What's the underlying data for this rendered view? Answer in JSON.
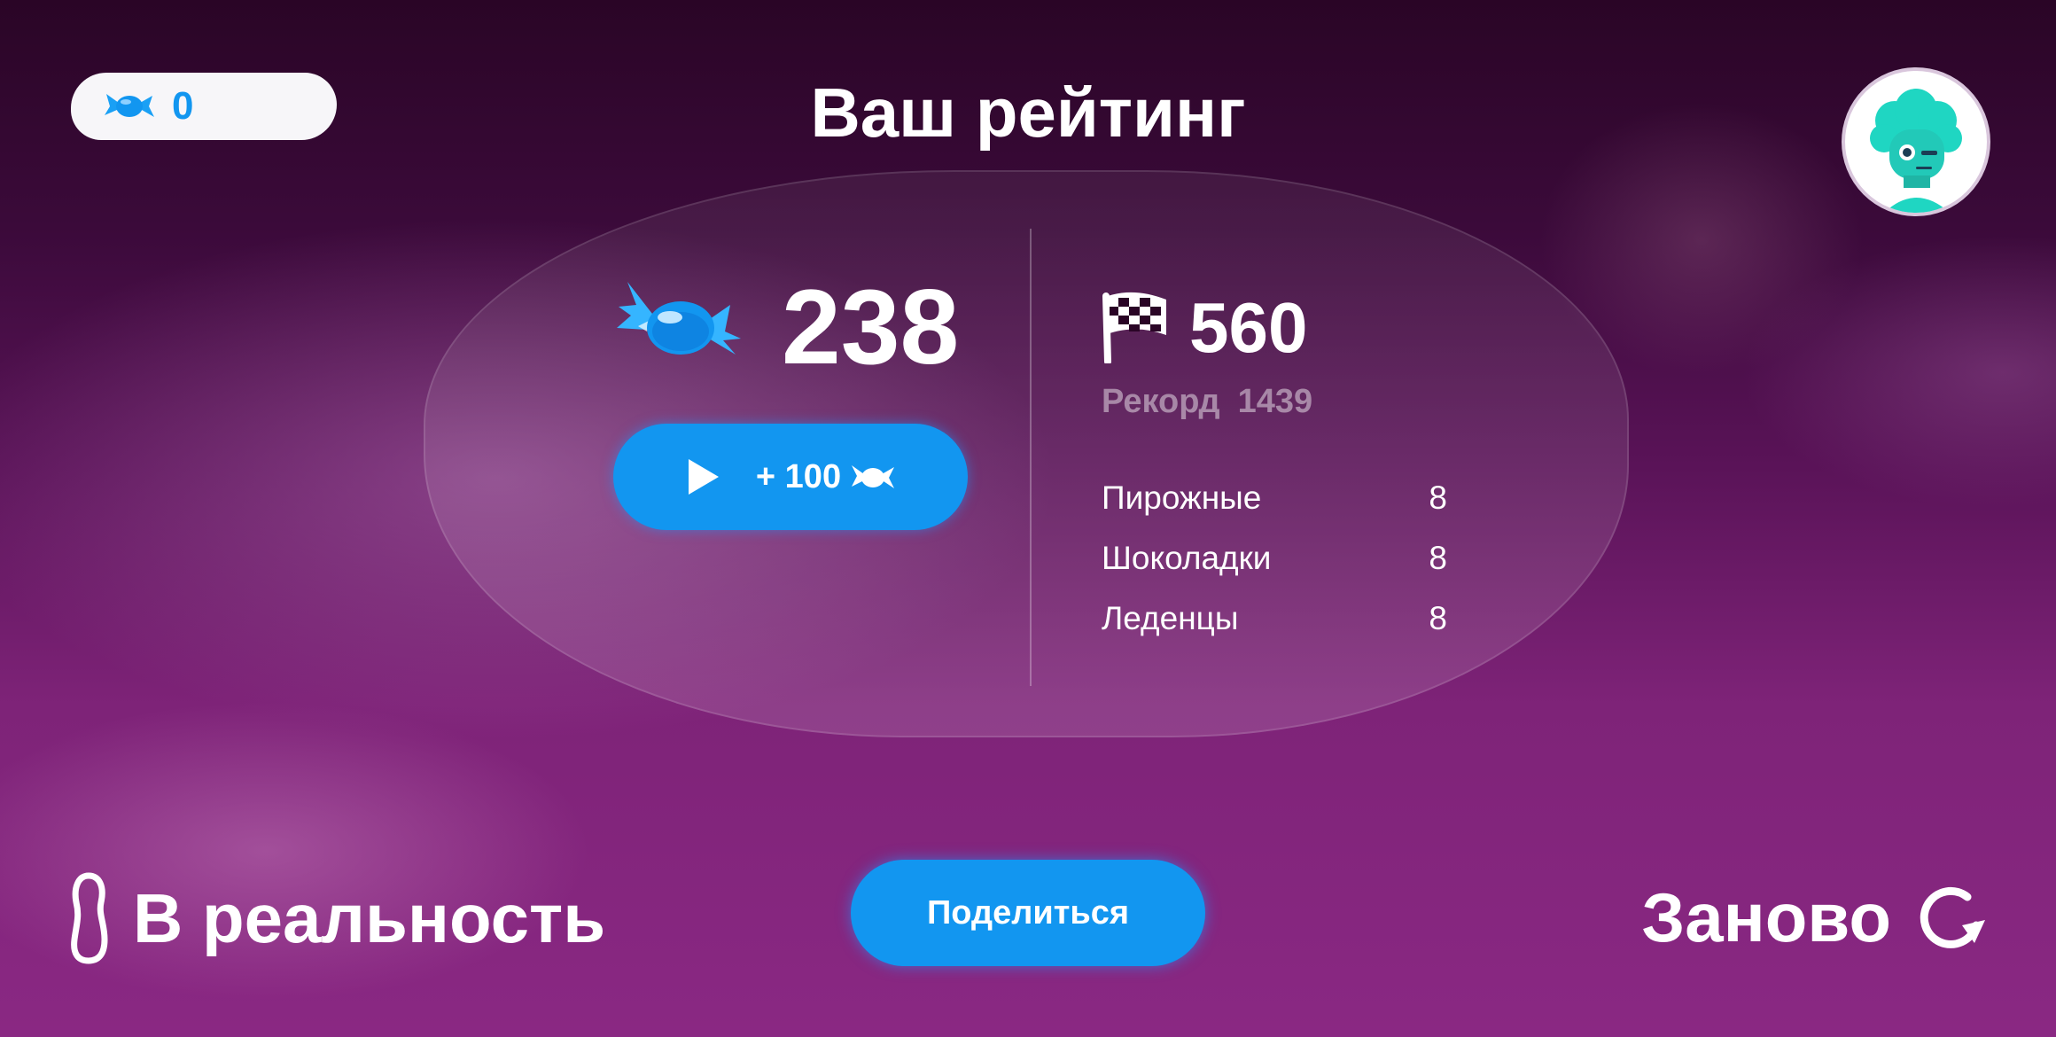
{
  "header": {
    "candy_count": "0",
    "title": "Ваш рейтинг"
  },
  "avatar": {
    "icon": "robot-avatar-icon"
  },
  "score": {
    "candies": "238",
    "watch_reward": "+ 100"
  },
  "distance": {
    "value": "560",
    "record_label": "Рекорд",
    "record_value": "1439"
  },
  "stats": [
    {
      "label": "Пирожные",
      "value": "8"
    },
    {
      "label": "Шоколадки",
      "value": "8"
    },
    {
      "label": "Леденцы",
      "value": "8"
    }
  ],
  "footer": {
    "reality_label": "В реальность",
    "share_label": "Поделиться",
    "again_label": "Заново"
  },
  "colors": {
    "accent": "#1296f0",
    "background_top": "#2a0526",
    "background_bottom": "#8a2883"
  }
}
